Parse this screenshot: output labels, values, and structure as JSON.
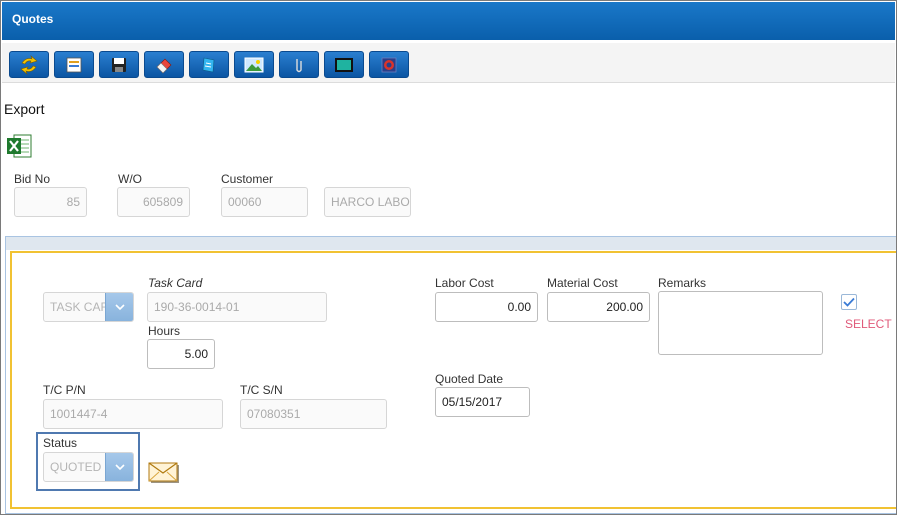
{
  "window": {
    "title": "Quotes"
  },
  "toolbar": {
    "buttons": [
      {
        "name": "refresh-button",
        "icon": "refresh-arrows-icon"
      },
      {
        "name": "new-record-button",
        "icon": "new-document-icon"
      },
      {
        "name": "save-button",
        "icon": "floppy-disk-icon"
      },
      {
        "name": "erase-button",
        "icon": "eraser-icon"
      },
      {
        "name": "notes-button",
        "icon": "notepad-icon"
      },
      {
        "name": "image-button",
        "icon": "picture-icon"
      },
      {
        "name": "attach-button",
        "icon": "paperclip-icon"
      },
      {
        "name": "screen-button",
        "icon": "monitor-icon"
      },
      {
        "name": "close-button",
        "icon": "stop-icon"
      }
    ]
  },
  "export": {
    "label": "Export",
    "icon": "excel-icon"
  },
  "header": {
    "bid_no": {
      "label": "Bid No",
      "value": "85"
    },
    "wo": {
      "label": "W/O",
      "value": "605809"
    },
    "customer": {
      "label": "Customer",
      "value": "00060",
      "name": "HARCO LABOR"
    }
  },
  "detail": {
    "type_select": {
      "value": "TASK CARD"
    },
    "task_card": {
      "label": "Task Card",
      "value": "190-36-0014-01"
    },
    "hours": {
      "label": "Hours",
      "value": "5.00"
    },
    "labor_cost": {
      "label": "Labor Cost",
      "value": "0.00"
    },
    "material_cost": {
      "label": "Material Cost",
      "value": "200.00"
    },
    "remarks": {
      "label": "Remarks",
      "value": ""
    },
    "select": {
      "label": "SELECT",
      "checked": true
    },
    "tc_pn": {
      "label": "T/C P/N",
      "value": "1001447-4"
    },
    "tc_sn": {
      "label": "T/C S/N",
      "value": "07080351"
    },
    "quoted_date": {
      "label": "Quoted Date",
      "value": "05/15/2017"
    },
    "status": {
      "label": "Status",
      "value": "QUOTED"
    },
    "email_icon": "envelope-icon"
  },
  "colors": {
    "title_bar": "#0a5fab",
    "toolbar_button": "#1565c0",
    "panel_border": "#f1c232",
    "select_link": "#e05a7a",
    "status_highlight": "#4f79b0"
  }
}
